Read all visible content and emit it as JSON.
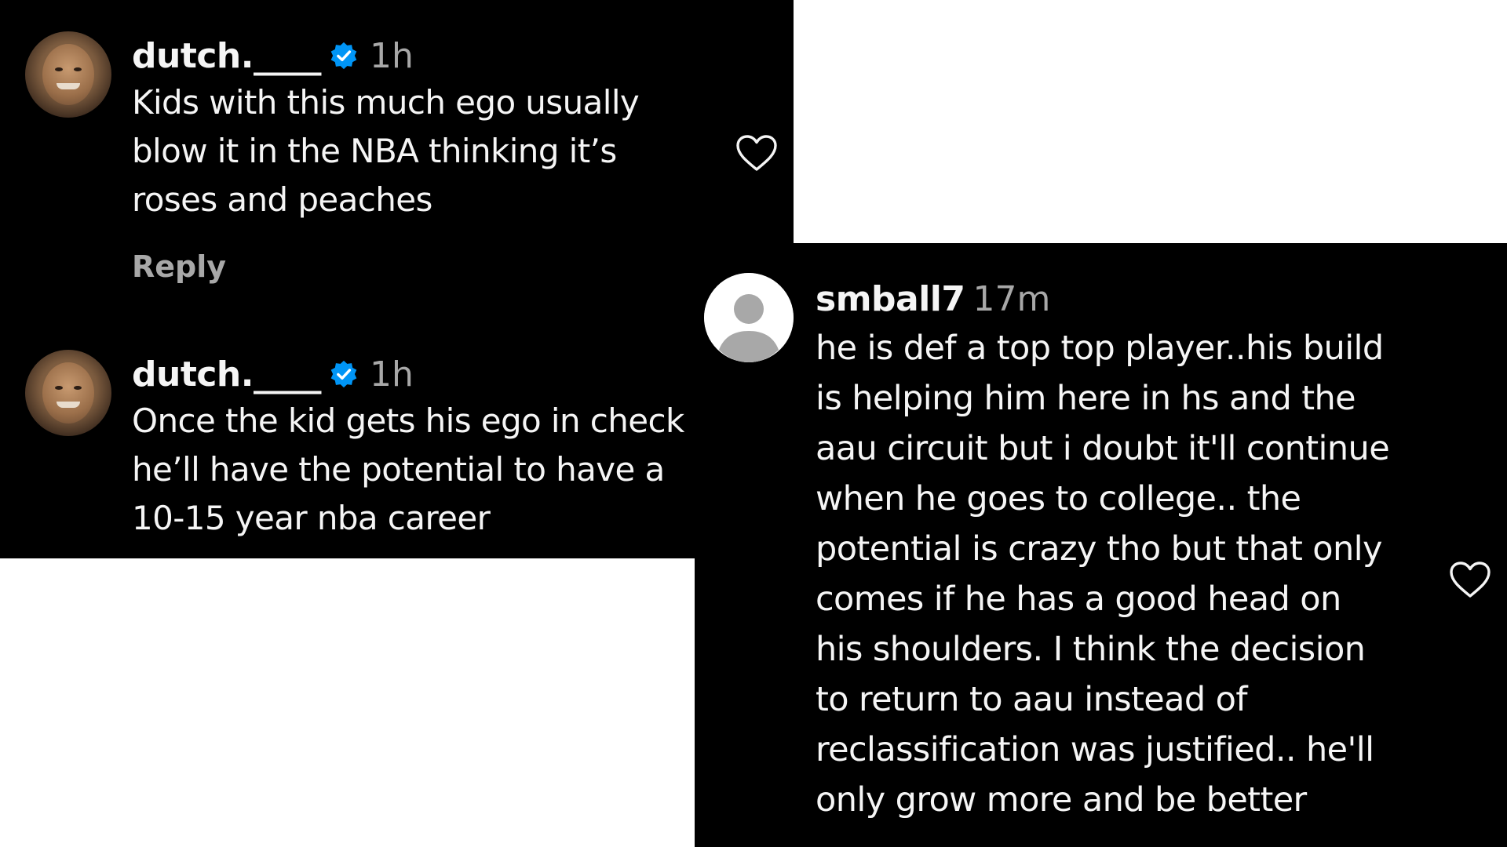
{
  "comments": [
    {
      "username": "dutch.____",
      "verified": true,
      "verified_icon": "verified-badge-icon",
      "time": "1h",
      "text_lines": [
        "Kids with this much ego usually",
        "blow it in the NBA thinking it’s",
        "roses and peaches"
      ],
      "reply_label": "Reply",
      "like_icon": "heart-icon"
    },
    {
      "username": "dutch.____",
      "verified": true,
      "verified_icon": "verified-badge-icon",
      "time": "1h",
      "text_lines": [
        "Once the kid gets his ego in check",
        "he’ll have the potential to have a",
        "10-15 year nba career"
      ]
    },
    {
      "username": "smball7",
      "verified": false,
      "time": "17m",
      "text_lines": [
        "he is def a top top player..his build",
        "is helping him here in hs and the",
        "aau circuit but i doubt it'll continue",
        "when he goes to college.. the",
        "potential is crazy tho but that only",
        "comes if he has a good head on",
        "his shoulders. I think the decision",
        "to return to aau instead of",
        "reclassification was justified.. he'll",
        "only grow more and be better"
      ],
      "like_icon": "heart-icon",
      "avatar_icon": "default-avatar-icon"
    }
  ],
  "colors": {
    "background": "#000000",
    "canvas": "#ffffff",
    "text": "#f5f5f5",
    "secondary_text": "#a8a8a8",
    "verified_blue": "#0095f6"
  }
}
